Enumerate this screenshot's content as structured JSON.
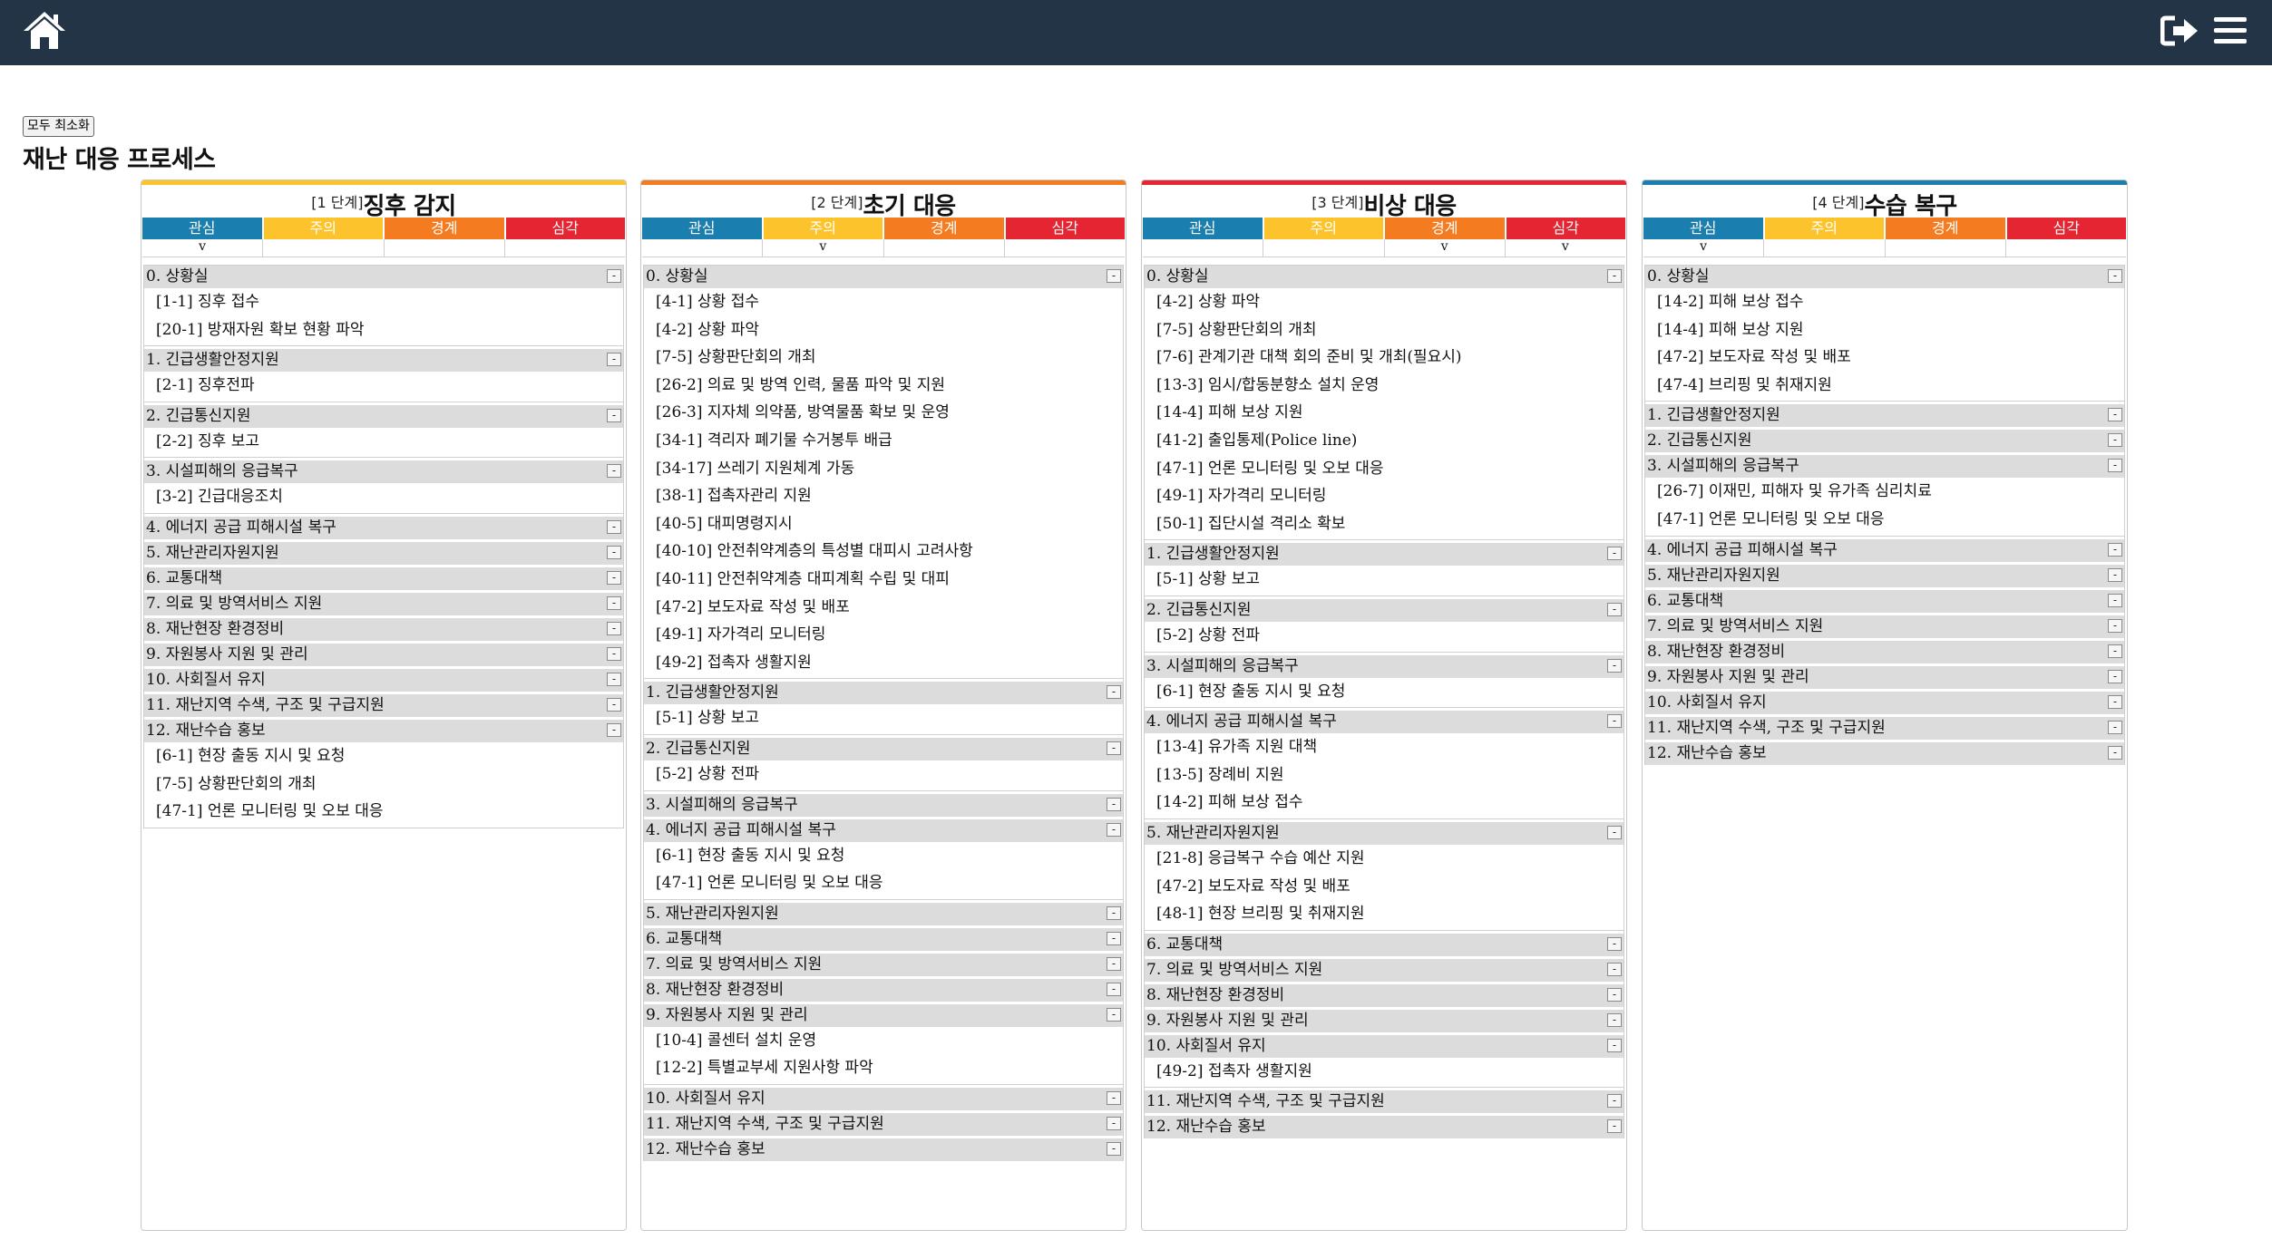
{
  "header": {
    "home_icon": "home-icon",
    "logout_icon": "logout-icon",
    "menu_icon": "hamburger-menu-icon",
    "bg_color": "#233447"
  },
  "toolbar": {
    "minimize_all_label": "모두 최소화"
  },
  "page": {
    "title": "재난 대응 프로세스"
  },
  "level_labels": [
    "관심",
    "주의",
    "경계",
    "심각"
  ],
  "level_colors": [
    "#1a7fae",
    "#fcc32c",
    "#f47b20",
    "#e62533"
  ],
  "stages": [
    {
      "step": "[1 단계]",
      "name": "징후 감지",
      "color": "#fcc32c",
      "marks": [
        "v",
        "",
        "",
        ""
      ],
      "groups": [
        {
          "title": "0. 상황실",
          "toggle": "-",
          "items": [
            "[1-1] 징후 접수",
            "[20-1] 방재자원 확보 현황 파악"
          ]
        },
        {
          "title": "1. 긴급생활안정지원",
          "toggle": "-",
          "items": [
            "[2-1] 징후전파"
          ]
        },
        {
          "title": "2. 긴급통신지원",
          "toggle": "-",
          "items": [
            "[2-2] 징후 보고"
          ]
        },
        {
          "title": "3. 시설피해의 응급복구",
          "toggle": "-",
          "items": [
            "[3-2] 긴급대응조치"
          ]
        },
        {
          "title": "4. 에너지 공급 피해시설 복구",
          "toggle": "-",
          "items": []
        },
        {
          "title": "5. 재난관리자원지원",
          "toggle": "-",
          "items": []
        },
        {
          "title": "6. 교통대책",
          "toggle": "-",
          "items": []
        },
        {
          "title": "7. 의료 및 방역서비스 지원",
          "toggle": "-",
          "items": []
        },
        {
          "title": "8. 재난현장 환경정비",
          "toggle": "-",
          "items": []
        },
        {
          "title": "9. 자원봉사 지원 및 관리",
          "toggle": "-",
          "items": []
        },
        {
          "title": "10. 사회질서 유지",
          "toggle": "-",
          "items": []
        },
        {
          "title": "11. 재난지역 수색, 구조 및 구급지원",
          "toggle": "-",
          "items": []
        },
        {
          "title": "12. 재난수습 홍보",
          "toggle": "-",
          "items": [
            "[6-1] 현장 출동 지시 및 요청",
            "[7-5] 상황판단회의 개최",
            "[47-1] 언론 모니터링 및 오보 대응"
          ]
        }
      ]
    },
    {
      "step": "[2 단계]",
      "name": "초기 대응",
      "color": "#f47b20",
      "marks": [
        "",
        "v",
        "",
        ""
      ],
      "groups": [
        {
          "title": "0. 상황실",
          "toggle": "-",
          "items": [
            "[4-1] 상황 접수",
            "[4-2] 상황 파악",
            "[7-5] 상황판단회의 개최",
            "[26-2] 의료 및 방역 인력, 물품 파악 및 지원",
            "[26-3] 지자체 의약품, 방역물품 확보 및 운영",
            "[34-1] 격리자 폐기물 수거봉투 배급",
            "[34-17] 쓰레기 지원체계 가동",
            "[38-1] 접촉자관리 지원",
            "[40-5] 대피명령지시",
            "[40-10] 안전취약계층의 특성별 대피시 고려사항",
            "[40-11] 안전취약계층 대피계획 수립 및 대피",
            "[47-2] 보도자료 작성 및 배포",
            "[49-1] 자가격리 모니터링",
            "[49-2] 접촉자 생활지원"
          ]
        },
        {
          "title": "1. 긴급생활안정지원",
          "toggle": "-",
          "items": [
            "[5-1] 상황 보고"
          ]
        },
        {
          "title": "2. 긴급통신지원",
          "toggle": "-",
          "items": [
            "[5-2] 상황 전파"
          ]
        },
        {
          "title": "3. 시설피해의 응급복구",
          "toggle": "-",
          "items": []
        },
        {
          "title": "4. 에너지 공급 피해시설 복구",
          "toggle": "-",
          "items": [
            "[6-1] 현장 출동 지시 및 요청",
            "[47-1] 언론 모니터링 및 오보 대응"
          ]
        },
        {
          "title": "5. 재난관리자원지원",
          "toggle": "-",
          "items": []
        },
        {
          "title": "6. 교통대책",
          "toggle": "-",
          "items": []
        },
        {
          "title": "7. 의료 및 방역서비스 지원",
          "toggle": "-",
          "items": []
        },
        {
          "title": "8. 재난현장 환경정비",
          "toggle": "-",
          "items": []
        },
        {
          "title": "9. 자원봉사 지원 및 관리",
          "toggle": "-",
          "items": [
            "[10-4] 콜센터 설치 운영",
            "[12-2] 특별교부세 지원사항 파악"
          ]
        },
        {
          "title": "10. 사회질서 유지",
          "toggle": "-",
          "items": []
        },
        {
          "title": "11. 재난지역 수색, 구조 및 구급지원",
          "toggle": "-",
          "items": []
        },
        {
          "title": "12. 재난수습 홍보",
          "toggle": "-",
          "items": []
        }
      ]
    },
    {
      "step": "[3 단계]",
      "name": "비상 대응",
      "color": "#e62533",
      "marks": [
        "",
        "",
        "v",
        "v"
      ],
      "groups": [
        {
          "title": "0. 상황실",
          "toggle": "-",
          "items": [
            "[4-2] 상황 파악",
            "[7-5] 상황판단회의 개최",
            "[7-6] 관계기관 대책 회의 준비 및 개최(필요시)",
            "[13-3] 임시/합동분향소 설치 운영",
            "[14-4] 피해 보상 지원",
            "[41-2] 출입통제(Police line)",
            "[47-1] 언론 모니터링 및 오보 대응",
            "[49-1] 자가격리 모니터링",
            "[50-1] 집단시설 격리소 확보"
          ]
        },
        {
          "title": "1. 긴급생활안정지원",
          "toggle": "-",
          "items": [
            "[5-1] 상황 보고"
          ]
        },
        {
          "title": "2. 긴급통신지원",
          "toggle": "-",
          "items": [
            "[5-2] 상황 전파"
          ]
        },
        {
          "title": "3. 시설피해의 응급복구",
          "toggle": "-",
          "items": [
            "[6-1] 현장 출동 지시 및 요청"
          ]
        },
        {
          "title": "4. 에너지 공급 피해시설 복구",
          "toggle": "-",
          "items": [
            "[13-4] 유가족 지원 대책",
            "[13-5] 장례비 지원",
            "[14-2] 피해 보상 접수"
          ]
        },
        {
          "title": "5. 재난관리자원지원",
          "toggle": "-",
          "items": [
            "[21-8] 응급복구 수습 예산 지원",
            "[47-2] 보도자료 작성 및 배포",
            "[48-1] 현장 브리핑 및 취재지원"
          ]
        },
        {
          "title": "6. 교통대책",
          "toggle": "-",
          "items": []
        },
        {
          "title": "7. 의료 및 방역서비스 지원",
          "toggle": "-",
          "items": []
        },
        {
          "title": "8. 재난현장 환경정비",
          "toggle": "-",
          "items": []
        },
        {
          "title": "9. 자원봉사 지원 및 관리",
          "toggle": "-",
          "items": []
        },
        {
          "title": "10. 사회질서 유지",
          "toggle": "-",
          "items": [
            "[49-2] 접촉자 생활지원"
          ]
        },
        {
          "title": "11. 재난지역 수색, 구조 및 구급지원",
          "toggle": "-",
          "items": []
        },
        {
          "title": "12. 재난수습 홍보",
          "toggle": "-",
          "items": []
        }
      ]
    },
    {
      "step": "[4 단계]",
      "name": "수습 복구",
      "color": "#1a7fae",
      "marks": [
        "v",
        "",
        "",
        ""
      ],
      "groups": [
        {
          "title": "0. 상황실",
          "toggle": "-",
          "items": [
            "[14-2] 피해 보상 접수",
            "[14-4] 피해 보상 지원",
            "[47-2] 보도자료 작성 및 배포",
            "[47-4] 브리핑 및 취재지원"
          ]
        },
        {
          "title": "1. 긴급생활안정지원",
          "toggle": "-",
          "items": []
        },
        {
          "title": "2. 긴급통신지원",
          "toggle": "-",
          "items": []
        },
        {
          "title": "3. 시설피해의 응급복구",
          "toggle": "-",
          "items": [
            "[26-7] 이재민, 피해자 및 유가족 심리치료",
            "[47-1] 언론 모니터링 및 오보 대응"
          ]
        },
        {
          "title": "4. 에너지 공급 피해시설 복구",
          "toggle": "-",
          "items": []
        },
        {
          "title": "5. 재난관리자원지원",
          "toggle": "-",
          "items": []
        },
        {
          "title": "6. 교통대책",
          "toggle": "-",
          "items": []
        },
        {
          "title": "7. 의료 및 방역서비스 지원",
          "toggle": "-",
          "items": []
        },
        {
          "title": "8. 재난현장 환경정비",
          "toggle": "-",
          "items": []
        },
        {
          "title": "9. 자원봉사 지원 및 관리",
          "toggle": "-",
          "items": []
        },
        {
          "title": "10. 사회질서 유지",
          "toggle": "-",
          "items": []
        },
        {
          "title": "11. 재난지역 수색, 구조 및 구급지원",
          "toggle": "-",
          "items": []
        },
        {
          "title": "12. 재난수습 홍보",
          "toggle": "-",
          "items": []
        }
      ]
    }
  ]
}
